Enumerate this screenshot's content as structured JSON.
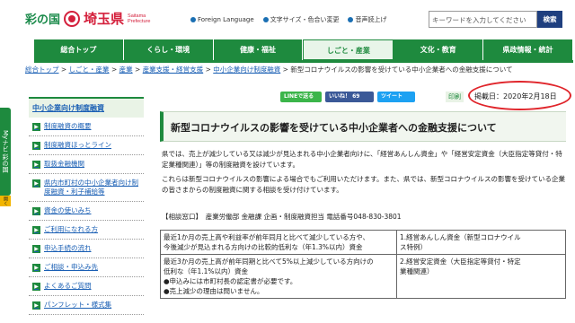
{
  "header": {
    "logo_sai": "彩の国",
    "logo_pref": "埼玉県",
    "logo_en_1": "Saitama",
    "logo_en_2": "Prefecture",
    "links": [
      "Foreign Language",
      "文字サイズ・色合い変更",
      "音声読上げ"
    ],
    "search_placeholder": "キーワードを入力してください",
    "search_button": "検索"
  },
  "nav": {
    "items": [
      "総合トップ",
      "くらし・環境",
      "健康・福祉",
      "しごと・産業",
      "文化・教育",
      "県政情報・統計"
    ],
    "active_index": 3
  },
  "breadcrumb": {
    "links": [
      "総合トップ",
      "しごと・産業",
      "産業",
      "産業支援・経営支援",
      "中小企業向け制度融資"
    ],
    "current": "新型コロナウイルスの影響を受けている中小企業者への金融支援について"
  },
  "side_tab": {
    "label": "Myナビ 彩の国",
    "action": "開く"
  },
  "sidebar": {
    "heading": "中小企業向け制度融資",
    "items": [
      "制度融資の概要",
      "制度融資ほっとライン",
      "取扱金融機関",
      "県内市町村の中小企業者向け制度融資・利子補給等",
      "資金の使いみち",
      "ご利用になれる方",
      "申込手続の流れ",
      "ご相談・申込み先",
      "よくあるご質問",
      "パンフレット・様式集"
    ]
  },
  "social": {
    "line": "LINEで送る",
    "facebook": "いいね！ 69",
    "twitter": "ツイート",
    "print": "印刷"
  },
  "posted": "掲載日：2020年2月18日",
  "article": {
    "title": "新型コロナウイルスの影響を受けている中小企業者への金融支援について",
    "p1": "県では、売上が減少している又は減少が見込まれる中小企業者向けに、「経営あんしん資金」や「経営安定資金（大臣指定等貸付・特定業種関連）」等の制度融資を設けています。",
    "p2": "これらは新型コロナウイルスの影響による場合でもご利用いただけます。また、県では、新型コロナウイルスの影響を受けている企業の皆さまからの制度融資に関する相談を受け付けています。",
    "contact": "【相談窓口】　産業労働部 金融課 企画・制度融資担当 電話番号048-830-3801",
    "table": [
      {
        "left": [
          "最近1か月の売上高や利益率が前年同月と比べて減少している方や、",
          "今後減少が見込まれる方向けの比較的低利な（年1.3%以内）資金"
        ],
        "right": [
          "1.経営あんしん資金（新型コロナウイル",
          "ス特例）"
        ]
      },
      {
        "left": [
          "最近3か月の売上高が前年同期と比べて5%以上減少している方向けの",
          "低利な（年1.1%以内）資金",
          "●申込みには市町村長の認定書が必要です。",
          "●売上減少の理由は問いません。"
        ],
        "right": [
          "2.経営安定資金（大臣指定等貸付・特定",
          "業種関連）"
        ]
      }
    ]
  },
  "colors": {
    "accent": "#1e8a3e",
    "brand_red": "#d4203c",
    "link": "#1a5fb4",
    "highlight": "#e0252b"
  }
}
